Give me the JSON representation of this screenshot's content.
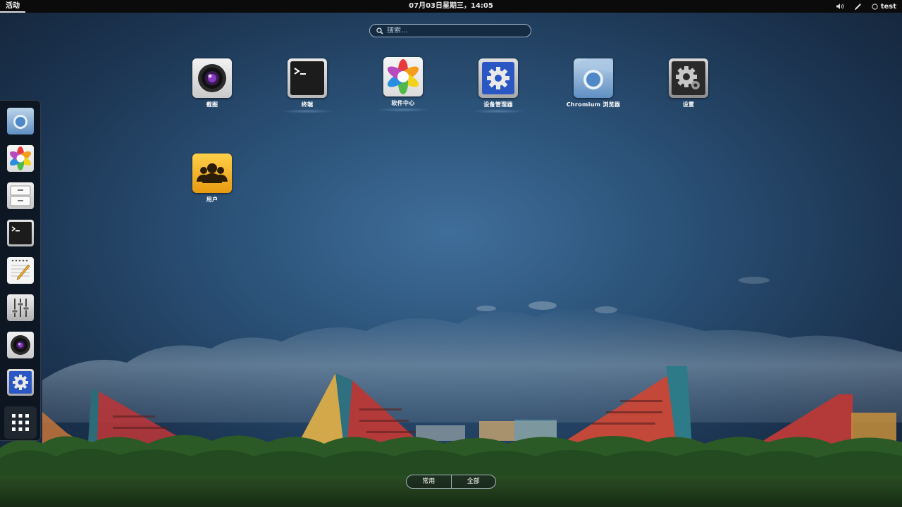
{
  "topbar": {
    "activities": "活动",
    "clock": "07月03日星期三，14:05",
    "user": "test",
    "icons": [
      "volume-icon",
      "pen-icon",
      "user-status-icon"
    ]
  },
  "search": {
    "placeholder": "搜索..."
  },
  "apps": [
    {
      "label": "截图",
      "icon": "camera-lens-icon"
    },
    {
      "label": "终端",
      "icon": "terminal-icon"
    },
    {
      "label": "软件中心",
      "icon": "software-center-icon"
    },
    {
      "label": "设备管理器",
      "icon": "device-manager-icon"
    },
    {
      "label": "Chromium 浏览器",
      "icon": "chromium-icon"
    },
    {
      "label": "设置",
      "icon": "settings-gear-icon"
    },
    {
      "label": "用户",
      "icon": "users-icon"
    }
  ],
  "dash": [
    "chromium-icon",
    "software-center-icon",
    "file-cabinet-icon",
    "terminal-icon",
    "text-editor-icon",
    "mixer-icon",
    "camera-lens-icon",
    "device-manager-icon",
    "show-apps-grid-icon"
  ],
  "view_toggle": {
    "frequent": "常用",
    "all": "全部"
  },
  "colors": {
    "topbar": "#0b0b0b",
    "sky": "#2b5278",
    "grass": "#2f5a2a"
  }
}
